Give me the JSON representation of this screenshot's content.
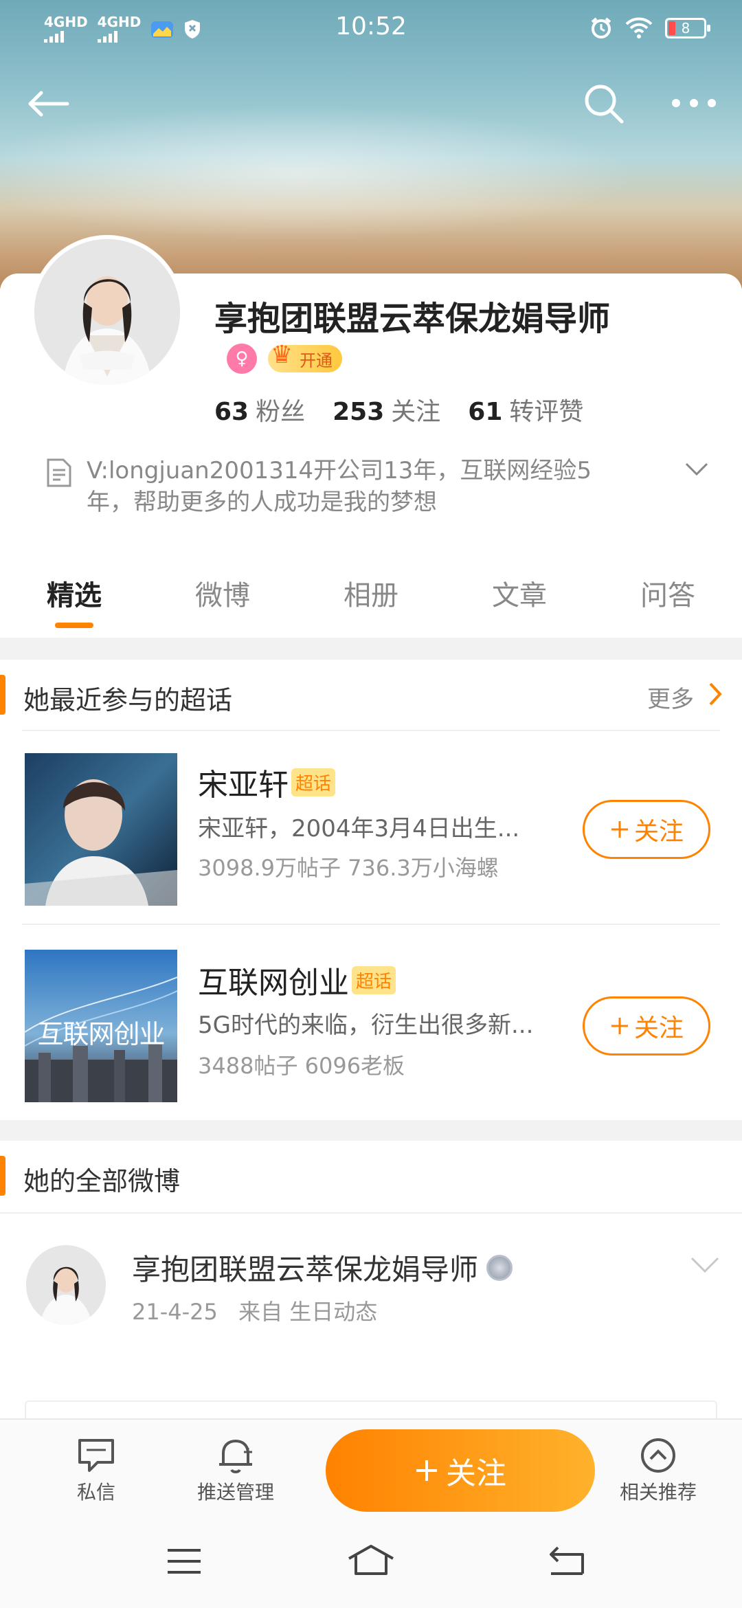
{
  "status_bar": {
    "time": "10:52",
    "signal_1": "4GHD",
    "signal_2": "4GHD",
    "battery": "8"
  },
  "profile": {
    "name": "享抱团联盟云萃保龙娟导师",
    "vip_label": "开通",
    "stats": [
      {
        "value": "63",
        "label": "粉丝"
      },
      {
        "value": "253",
        "label": "关注"
      },
      {
        "value": "61",
        "label": "转评赞"
      }
    ],
    "bio_line1": "V:longjuan2001314开公司13年，互联网经验5",
    "bio_line2": "年，帮助更多的人成功是我的梦想"
  },
  "tabs": [
    "精选",
    "微博",
    "相册",
    "文章",
    "问答"
  ],
  "supertopics": {
    "title": "她最近参与的超话",
    "more": "更多",
    "items": [
      {
        "name": "宋亚轩",
        "tag": "超话",
        "desc": "宋亚轩，2004年3月4日出生...",
        "stats": "3098.9万帖子 736.3万小海螺",
        "follow": "关注"
      },
      {
        "name": "互联网创业",
        "tag": "超话",
        "desc": "5G时代的来临，衍生出很多新...",
        "stats": "3488帖子 6096老板",
        "follow": "关注",
        "thumb_text": "互联网创业"
      }
    ]
  },
  "posts": {
    "title": "她的全部微博",
    "items": [
      {
        "author": "享抱团联盟云萃保龙娟导师",
        "date": "21-4-25",
        "source": "来自 生日动态"
      }
    ]
  },
  "actions": {
    "message": "私信",
    "push": "推送管理",
    "follow": "关注",
    "related": "相关推荐"
  },
  "colors": {
    "accent": "#ff8200",
    "text_primary": "#222222",
    "text_secondary": "#888888"
  }
}
